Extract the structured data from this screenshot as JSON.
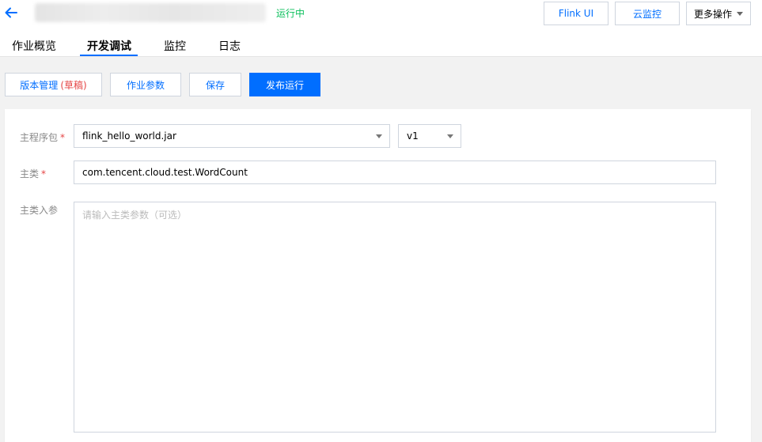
{
  "header": {
    "status": "运行中",
    "flink_ui": "Flink UI",
    "cloud_monitor": "云监控",
    "more_actions": "更多操作"
  },
  "tabs": [
    {
      "label": "作业概览"
    },
    {
      "label": "开发调试"
    },
    {
      "label": "监控"
    },
    {
      "label": "日志"
    }
  ],
  "toolbar": {
    "version_mgmt": "版本管理",
    "draft": "(草稿)",
    "job_params": "作业参数",
    "save": "保存",
    "publish_run": "发布运行"
  },
  "form": {
    "main_package_label": "主程序包",
    "main_package_value": "flink_hello_world.jar",
    "version_value": "v1",
    "main_class_label": "主类",
    "main_class_value": "com.tencent.cloud.test.WordCount",
    "main_args_label": "主类入参",
    "main_args_placeholder": "请输入主类参数（可选）",
    "required_mark": "*"
  },
  "colors": {
    "accent": "#006eff",
    "status_running": "#0abf5b",
    "required": "#e54545"
  }
}
